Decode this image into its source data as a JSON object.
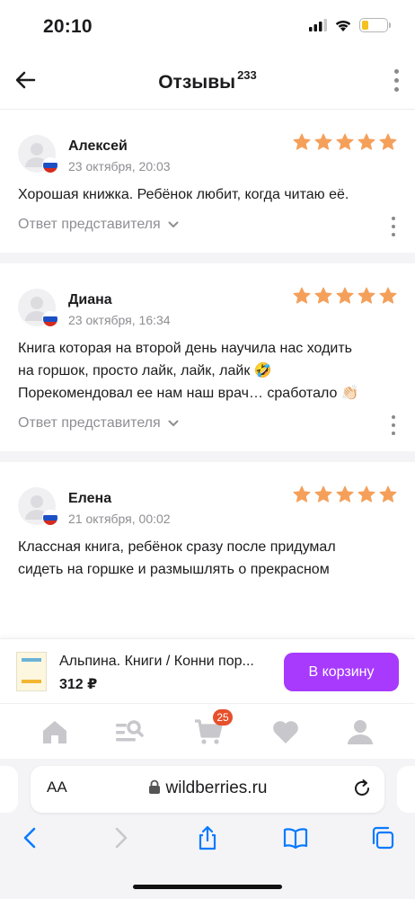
{
  "status_bar": {
    "time": "20:10",
    "battery_level": 0.25,
    "battery_color": "#f5c11f"
  },
  "header": {
    "title": "Отзывы",
    "count": "233"
  },
  "reviews": [
    {
      "name": "Алексей",
      "date": "23 октября, 20:03",
      "rating": 5,
      "text": "Хорошая книжка. Ребёнок любит, когда читаю её.",
      "reply_label": "Ответ представителя"
    },
    {
      "name": "Диана",
      "date": "23 октября, 16:34",
      "rating": 5,
      "text": "Книга которая на второй день научила нас ходить на горшок, просто лайк, лайк, лайк 🤣 Порекомендовал ее нам наш врач… сработало 👏🏻",
      "reply_label": "Ответ представителя"
    },
    {
      "name": "Елена",
      "date": "21 октября, 00:02",
      "rating": 5,
      "text": "Классная книга, ребёнок сразу после придумал сидеть на горшке и размышлять о прекрасном",
      "reply_label": ""
    }
  ],
  "product_bar": {
    "name": "Альпина. Книги / Конни пор...",
    "price": "312 ₽",
    "cart_button": "В корзину"
  },
  "tab_bar": {
    "items": [
      "home-icon",
      "catalog-search-icon",
      "cart-icon",
      "favorites-heart-icon",
      "profile-icon"
    ],
    "cart_badge": "25"
  },
  "browser": {
    "text_size_label": "AA",
    "url": "wildberries.ru"
  },
  "colors": {
    "star": "#f5a05a",
    "accent": "#a73afd",
    "badge": "#e6502b",
    "safari_blue": "#0a7aff"
  }
}
